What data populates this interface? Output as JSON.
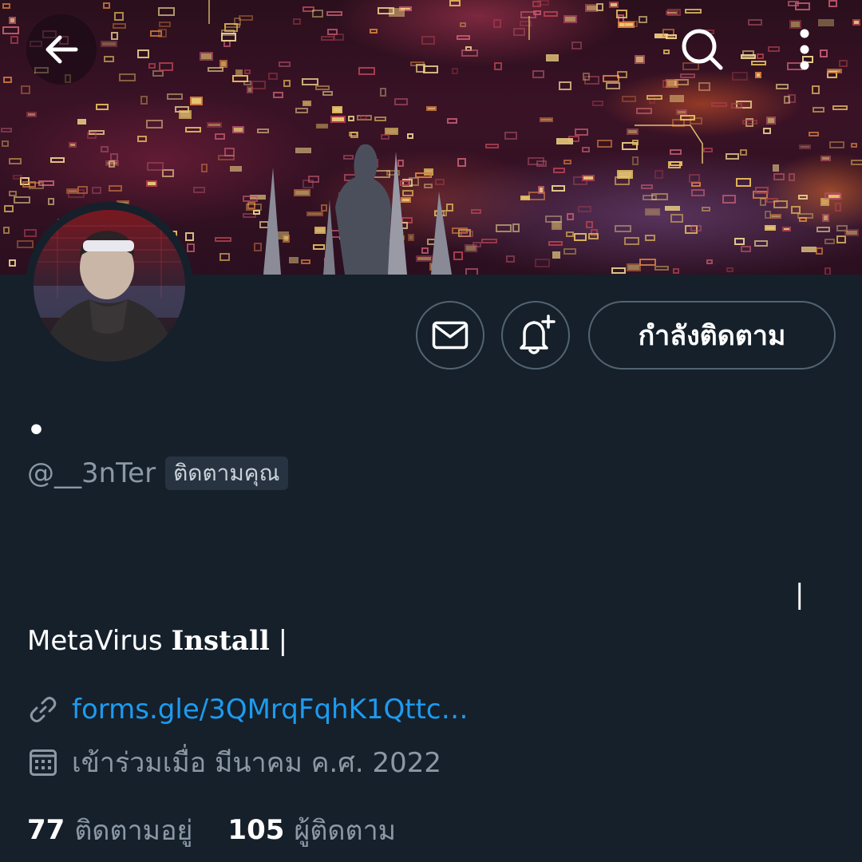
{
  "header": {
    "back_icon": "arrow-left-icon",
    "search_icon": "search-icon",
    "more_icon": "more-vertical-icon"
  },
  "actions": {
    "message_icon": "mail-icon",
    "notify_icon": "bell-plus-icon",
    "follow_label": "กำลังติดตาม"
  },
  "profile": {
    "display_name": "•",
    "handle": "@__3nTer",
    "follows_you_label": "ติดตามคุณ",
    "bio_stray_bar": "|",
    "bio_prefix": "MetaVirus ",
    "bio_styled": "Install",
    "bio_suffix": " |",
    "link": "forms.gle/3QMrqFqhK1Qttc…",
    "joined": "เข้าร่วมเมื่อ มีนาคม ค.ศ. 2022"
  },
  "stats": {
    "following_count": "77",
    "following_label": "ติดตามอยู่",
    "followers_count": "105",
    "followers_label": "ผู้ติดตาม"
  },
  "colors": {
    "background": "#15202b",
    "muted_text": "#8b98a5",
    "link": "#1d9bf0",
    "border": "#536471"
  }
}
